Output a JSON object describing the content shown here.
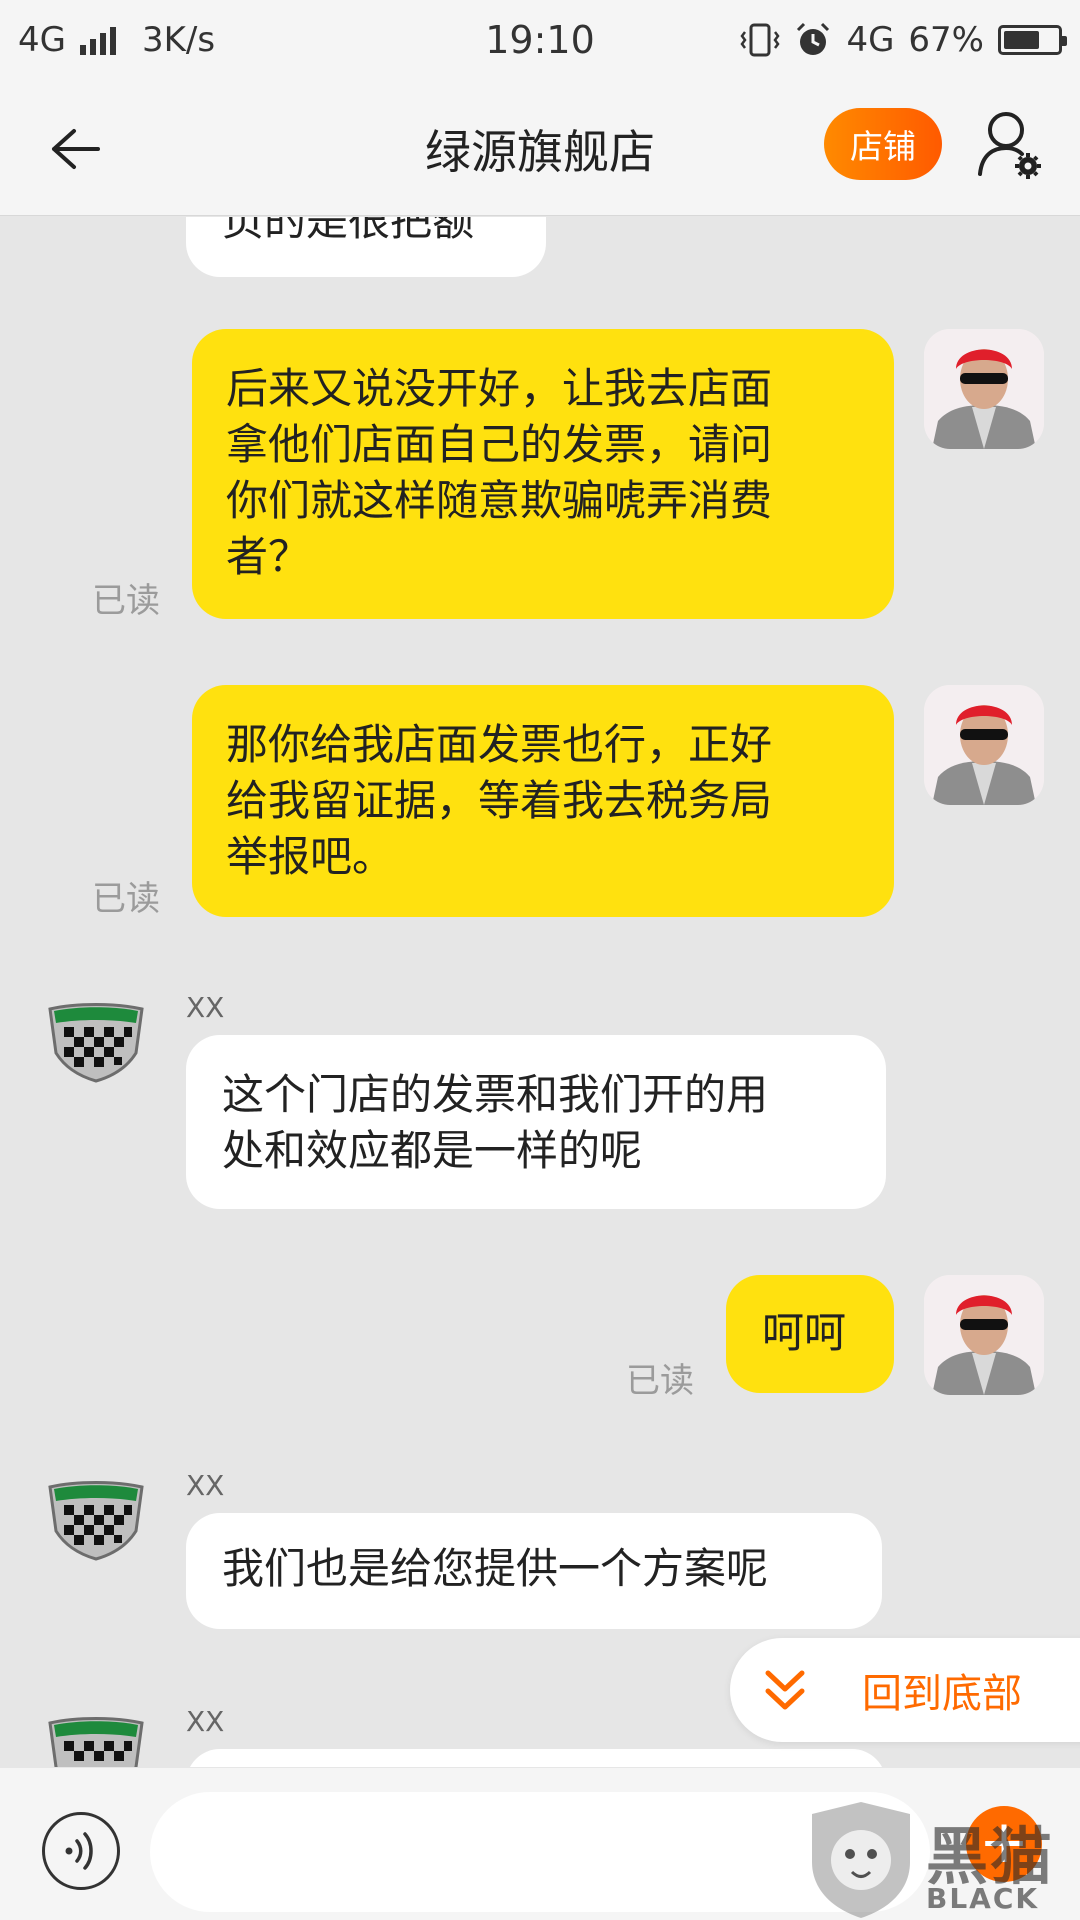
{
  "status_bar": {
    "network": "4G",
    "speed": "3K/s",
    "time": "19:10",
    "network_right": "4G",
    "battery_percent": "67%",
    "battery_level": 0.67
  },
  "nav": {
    "title": "绿源旗舰店",
    "shop_button": "店铺"
  },
  "chat": {
    "read_label": "已读",
    "partial_top_text": "页的是很把额",
    "messages": [
      {
        "side": "right",
        "lines": [
          "后来又说没开好，让我去店面",
          "拿他们店面自己的发票，请问",
          "你们就这样随意欺骗唬弄消费",
          "者？"
        ]
      },
      {
        "side": "right",
        "lines": [
          "那你给我店面发票也行，正好",
          "给我留证据，等着我去税务局",
          "举报吧。"
        ]
      },
      {
        "side": "left",
        "sender": "XX",
        "lines": [
          "这个门店的发票和我们开的用",
          "处和效应都是一样的呢"
        ]
      },
      {
        "side": "right",
        "lines": [
          "呵呵"
        ]
      },
      {
        "side": "left",
        "sender": "XX",
        "lines": [
          "我们也是给您提供一个方案呢"
        ]
      },
      {
        "side": "left",
        "sender": "XX",
        "lines": []
      }
    ]
  },
  "jump_to_bottom": "回到底部",
  "input": {
    "placeholder": "",
    "add_label": "+"
  },
  "watermark": {
    "brand": "黑猫",
    "brand_en": "BLACK CAT"
  },
  "colors": {
    "accent": "#ff6a00",
    "bubble_self": "#ffe10f",
    "bubble_other": "#ffffff",
    "chat_background": "#e6e6e6"
  }
}
